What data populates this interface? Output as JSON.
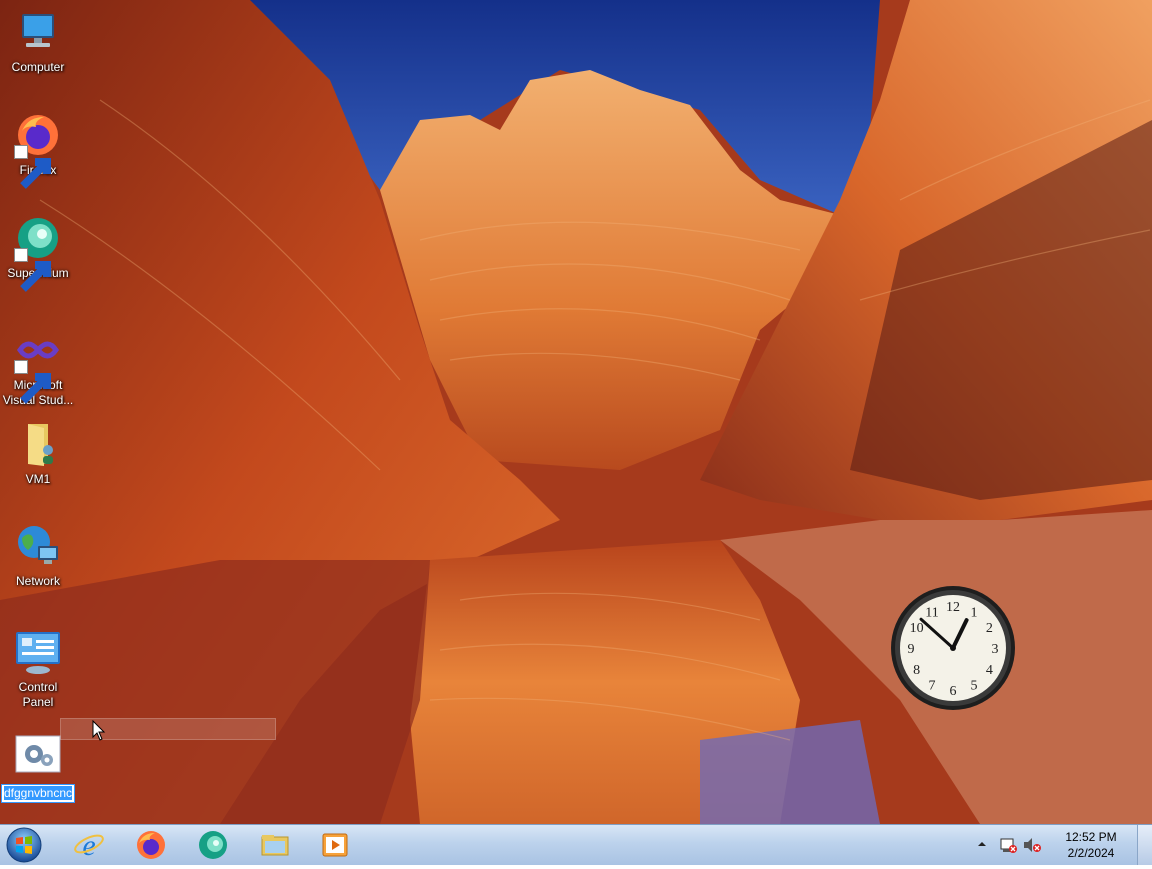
{
  "desktop": {
    "icons": [
      {
        "label": "Computer",
        "icon": "computer-icon"
      },
      {
        "label": "Firefox",
        "icon": "firefox-icon",
        "shortcut": true
      },
      {
        "label": "Supermium",
        "icon": "supermium-icon",
        "shortcut": true
      },
      {
        "label": "Microsoft Visual Stud...",
        "icon": "visual-studio-icon",
        "shortcut": true
      },
      {
        "label": "VM1",
        "icon": "folder-icon"
      },
      {
        "label": "Network",
        "icon": "network-icon"
      },
      {
        "label": "Control Panel",
        "icon": "control-panel-icon"
      },
      {
        "label": "dfggnvbncnc",
        "icon": "settings-file-icon",
        "renaming": true
      }
    ]
  },
  "gadget": {
    "clock": {
      "hour": 12,
      "minute": 52,
      "numerals": [
        "12",
        "1",
        "2",
        "3",
        "4",
        "5",
        "6",
        "7",
        "8",
        "9",
        "10",
        "11"
      ]
    }
  },
  "taskbar": {
    "start": "start-button",
    "pinned": [
      {
        "name": "Internet Explorer",
        "icon": "internet-explorer-icon"
      },
      {
        "name": "Firefox",
        "icon": "firefox-icon"
      },
      {
        "name": "Supermium",
        "icon": "supermium-icon"
      },
      {
        "name": "Windows Explorer",
        "icon": "file-explorer-icon"
      },
      {
        "name": "Media Player",
        "icon": "media-player-icon"
      }
    ],
    "tray": {
      "time": "12:52 PM",
      "date": "2/2/2024",
      "icons": [
        "show-hidden-icons",
        "action-center-icon",
        "volume-muted-icon"
      ]
    }
  },
  "colors": {
    "taskbar": "#bcd2ec",
    "selection": "#3399ff",
    "sky": "#1d3f9a"
  }
}
